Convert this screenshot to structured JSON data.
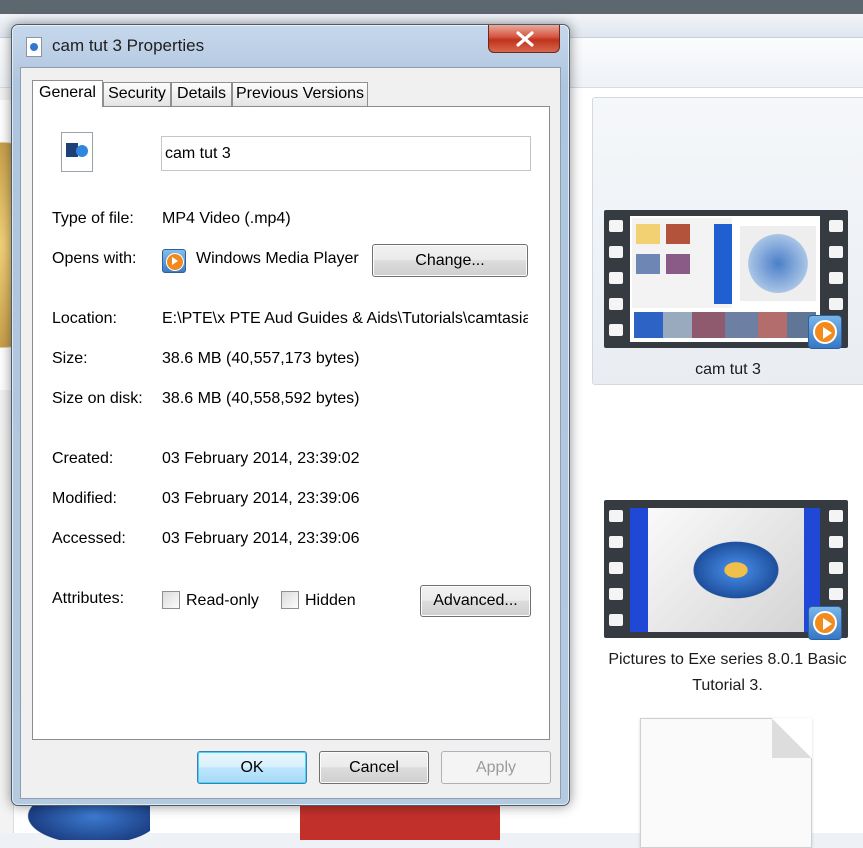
{
  "window": {
    "title": "cam tut 3 Properties"
  },
  "tabs": [
    {
      "label": "General",
      "active": true
    },
    {
      "label": "Security",
      "active": false
    },
    {
      "label": "Details",
      "active": false
    },
    {
      "label": "Previous Versions",
      "active": false
    }
  ],
  "general": {
    "file_name": "cam tut 3",
    "type_label": "Type of file:",
    "type_value": "MP4 Video (.mp4)",
    "opens_label": "Opens with:",
    "opens_value": "Windows Media Player",
    "change_button": "Change...",
    "location_label": "Location:",
    "location_value": "E:\\PTE\\x PTE Aud Guides & Aids\\Tutorials\\camtasia",
    "size_label": "Size:",
    "size_value": "38.6 MB (40,557,173 bytes)",
    "size_on_disk_label": "Size on disk:",
    "size_on_disk_value": "38.6 MB (40,558,592 bytes)",
    "created_label": "Created:",
    "created_value": "03 February 2014, 23:39:02",
    "modified_label": "Modified:",
    "modified_value": "03 February 2014, 23:39:06",
    "accessed_label": "Accessed:",
    "accessed_value": "03 February 2014, 23:39:06",
    "attributes_label": "Attributes:",
    "readonly_label": "Read-only",
    "readonly_checked": false,
    "hidden_label": "Hidden",
    "hidden_checked": false,
    "advanced_button": "Advanced..."
  },
  "footer": {
    "ok_button": "OK",
    "cancel_button": "Cancel",
    "apply_button": "Apply"
  },
  "background_explorer": {
    "items": [
      {
        "label": "cam tut 3",
        "icon": "video-thumbnail-icon",
        "selected": true
      },
      {
        "label_line1": "Pictures to Exe series 8.0.1 Basic",
        "label_line2": "Tutorial 3.",
        "icon": "video-thumbnail-icon",
        "selected": false
      },
      {
        "label": "",
        "icon": "document-icon",
        "selected": false
      }
    ]
  },
  "colors": {
    "close_button": "#c7402a",
    "default_button_border": "#3c7fb1",
    "window_frame": "#b9cde4"
  }
}
